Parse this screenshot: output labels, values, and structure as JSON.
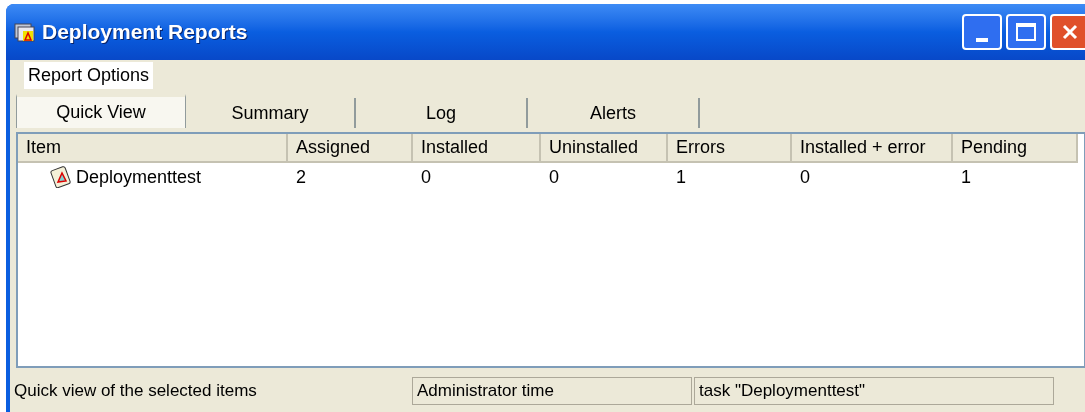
{
  "window": {
    "title": "Deployment Reports"
  },
  "menu": [
    {
      "label": "Report Options"
    }
  ],
  "tabs": [
    {
      "label": "Quick View",
      "selected": true
    },
    {
      "label": "Summary",
      "selected": false
    },
    {
      "label": "Log",
      "selected": false
    },
    {
      "label": "Alerts",
      "selected": false
    }
  ],
  "table": {
    "columns": [
      "Item",
      "Assigned",
      "Installed",
      "Uninstalled",
      "Errors",
      "Installed + error",
      "Pending"
    ],
    "rows": [
      {
        "cells": [
          "Deploymenttest",
          "2",
          "0",
          "0",
          "1",
          "0",
          "1"
        ]
      }
    ]
  },
  "status_bar": [
    "Quick view of the selected items",
    "Administrator time",
    "task \"Deploymenttest\""
  ]
}
